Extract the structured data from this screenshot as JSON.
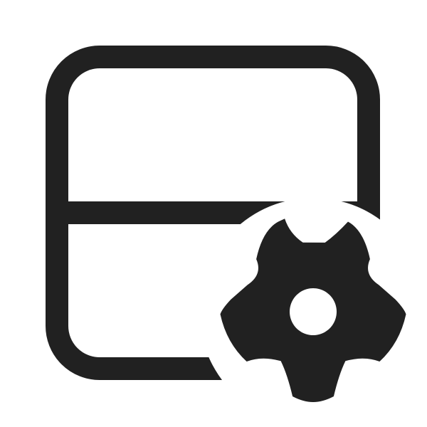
{
  "icon": {
    "name": "table-split-settings-icon",
    "parts": [
      "table-frame-icon",
      "horizontal-divider",
      "gear-icon"
    ],
    "colors": {
      "stroke": "#212121",
      "fill": "#212121",
      "background": "#ffffff"
    }
  }
}
